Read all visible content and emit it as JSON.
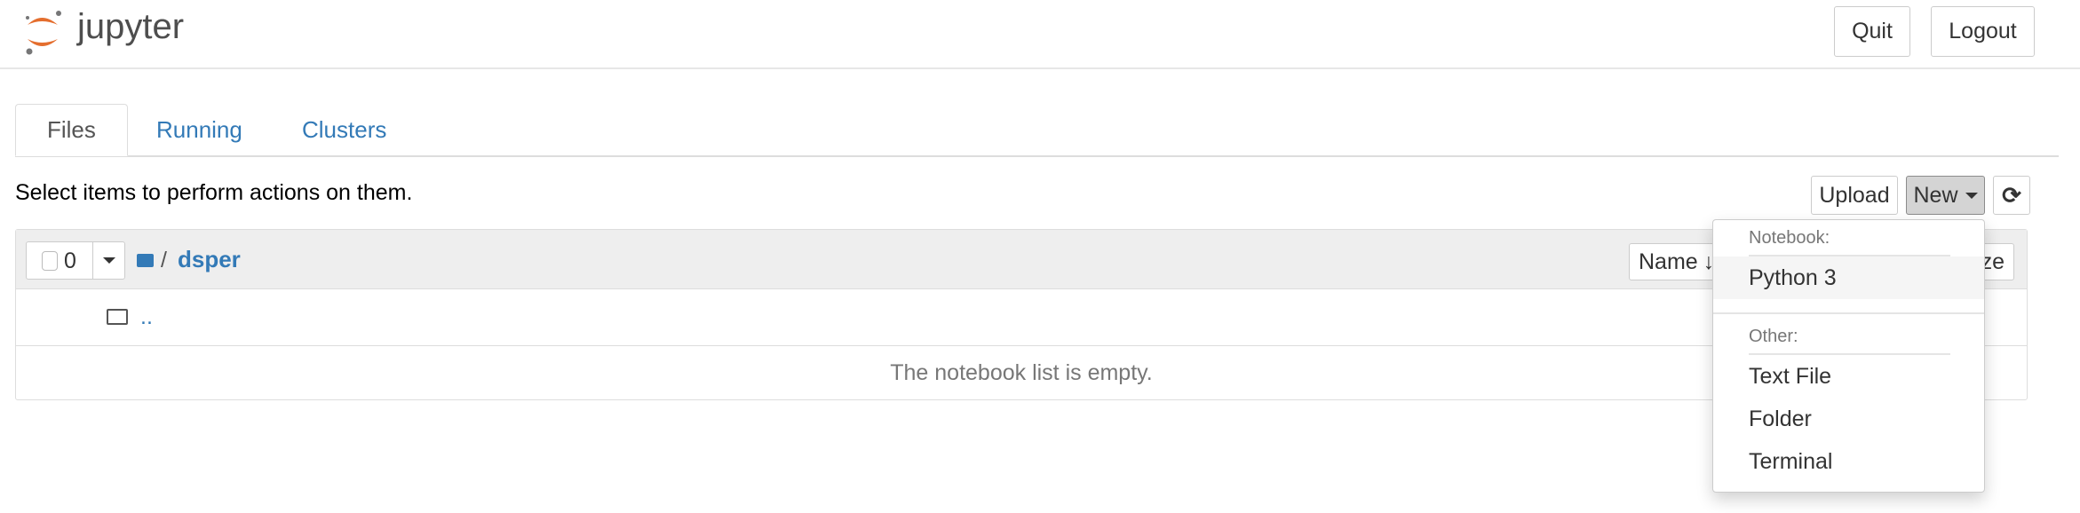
{
  "header": {
    "logo_text": "jupyter",
    "quit_label": "Quit",
    "logout_label": "Logout"
  },
  "tabs": [
    {
      "label": "Files",
      "active": true
    },
    {
      "label": "Running"
    },
    {
      "label": "Clusters"
    }
  ],
  "toolbar": {
    "hint": "Select items to perform actions on them.",
    "upload_label": "Upload",
    "new_label": "New",
    "refresh_icon": "refresh-icon"
  },
  "list": {
    "selected_count": "0",
    "breadcrumb_sep": "/",
    "folder": "dsper",
    "sort_name_label": "Name",
    "sort_size_label": "ze",
    "parent_dir": "..",
    "empty_message": "The notebook list is empty."
  },
  "new_menu": {
    "notebook_header": "Notebook:",
    "notebook_items": [
      "Python 3"
    ],
    "other_header": "Other:",
    "other_items": [
      "Text File",
      "Folder",
      "Terminal"
    ]
  },
  "colors": {
    "link": "#337ab7",
    "logo_orange": "#e46e2e"
  }
}
